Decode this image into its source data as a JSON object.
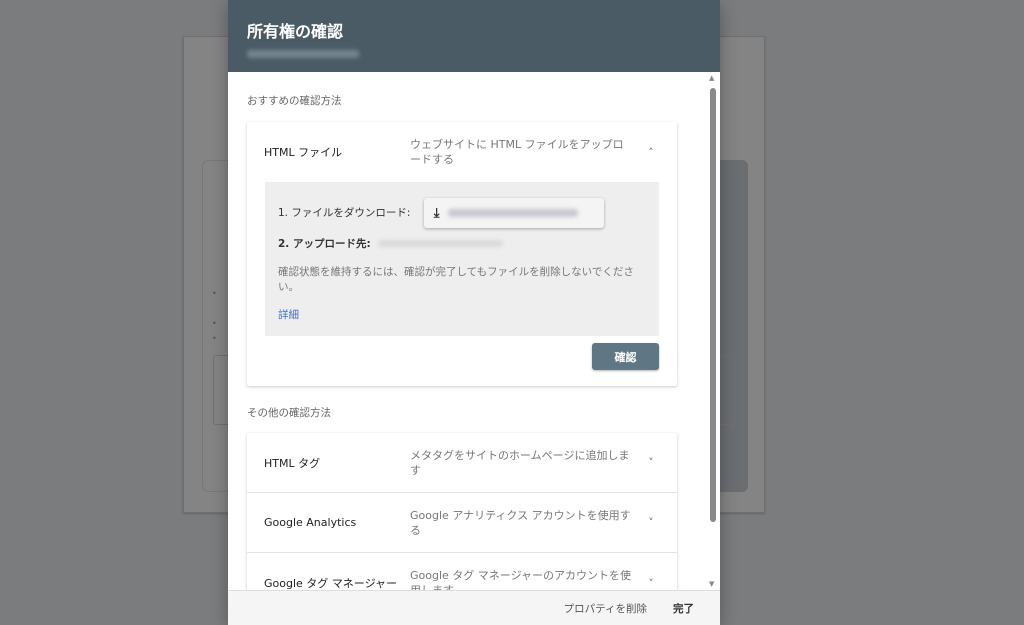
{
  "dialog": {
    "title": "所有権の確認",
    "recommended_label": "おすすめの確認方法",
    "recommended": {
      "name": "HTML ファイル",
      "desc": "ウェブサイトに HTML ファイルをアップロードする",
      "step1": "1. ファイルをダウンロード:",
      "step2": "2. アップロード先:",
      "note": "確認状態を維持するには、確認が完了してもファイルを削除しないでください。",
      "details_link": "詳細",
      "confirm_button": "確認"
    },
    "other_label": "その他の確認方法",
    "others": [
      {
        "name": "HTML タグ",
        "desc": "メタタグをサイトのホームページに追加します"
      },
      {
        "name": "Google Analytics",
        "desc": "Google アナリティクス アカウントを使用する"
      },
      {
        "name": "Google タグ マネージャー",
        "desc": "Google タグ マネージャーのアカウントを使用します"
      }
    ],
    "footer": {
      "delete_property": "プロパティを削除",
      "done": "完了"
    }
  }
}
